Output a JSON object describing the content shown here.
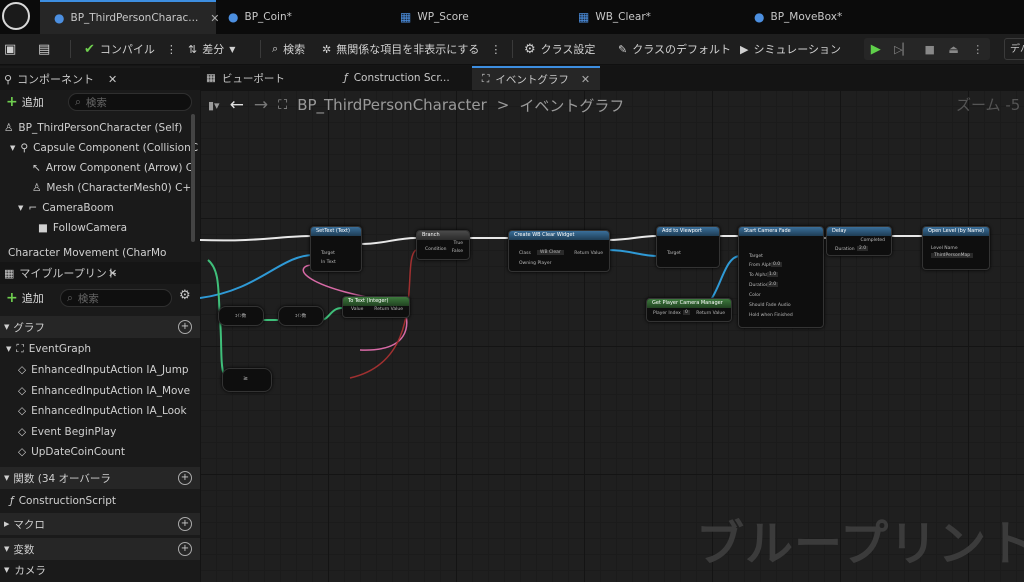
{
  "tabs": [
    {
      "label": "BP_ThirdPersonCharac...",
      "close": "✕"
    },
    {
      "label": "BP_Coin*"
    },
    {
      "label": "WP_Score"
    },
    {
      "label": "WB_Clear*"
    },
    {
      "label": "BP_MoveBox*"
    }
  ],
  "toolbar": {
    "compile": "コンパイル",
    "diff": "差分",
    "search": "検索",
    "hide_unrelated": "無関係な項目を非表示にする",
    "class_settings": "クラス設定",
    "class_defaults": "クラスのデフォルト",
    "simulation": "シミュレーション",
    "right_label": "デバ"
  },
  "components_panel": {
    "title": "コンポーネント",
    "add": "追加",
    "search_placeholder": "検索",
    "items": [
      "BP_ThirdPersonCharacter (Self)",
      "Capsule Component (CollisionC",
      "Arrow Component (Arrow)  C",
      "Mesh (CharacterMesh0)  C+",
      "CameraBoom",
      "FollowCamera",
      "Character Movement (CharMo"
    ]
  },
  "blueprint_panel": {
    "title": "マイブループリント",
    "add": "追加",
    "search_placeholder": "検索",
    "graph_header": "グラフ",
    "graph_items": [
      "EventGraph",
      "EnhancedInputAction IA_Jump",
      "EnhancedInputAction IA_Move",
      "EnhancedInputAction IA_Look",
      "Event BeginPlay",
      "UpDateCoinCount"
    ],
    "functions_header": "関数 (34 オーバーラ",
    "function_items": [
      "ConstructionScript"
    ],
    "macro_header": "マクロ",
    "variables_header": "変数",
    "variable_category": "カメラ"
  },
  "graph_tabs": {
    "viewport": "ビューポート",
    "construction": "Construction Scr...",
    "event_graph": "イベントグラフ"
  },
  "breadcrumb": {
    "blueprint": "BP_ThirdPersonCharacter",
    "separator": ">",
    "graph": "イベントグラフ",
    "zoom": "ズーム -5"
  },
  "watermark": "ブループリント",
  "nodes": {
    "set_text": {
      "title": "SetText (Text)",
      "sub": "Target is Text",
      "pins": [
        "Target",
        "In Text"
      ]
    },
    "branch": {
      "title": "Branch",
      "pins": [
        "Condition",
        "True",
        "False"
      ]
    },
    "create_widget": {
      "title": "Create WB Clear Widget",
      "pins": [
        "Class",
        "Owning Player",
        "Return Value"
      ],
      "class_value": "WB Clear"
    },
    "add_to_viewport": {
      "title": "Add to Viewport",
      "sub": "Target is User Widget",
      "pins": [
        "Target"
      ]
    },
    "start_camera_fade": {
      "title": "Start Camera Fade",
      "sub": "Target is Player Camera Manager",
      "pins": [
        "Target",
        "From Alpha",
        "To Alpha",
        "Duration",
        "Color",
        "Should Fade Audio",
        "Hold when Finished"
      ],
      "values": [
        "0.0",
        "1.0",
        "2.0"
      ]
    },
    "delay": {
      "title": "Delay",
      "pins": [
        "Duration",
        "Completed"
      ],
      "value": "2.0"
    },
    "open_level": {
      "title": "Open Level (by Name)",
      "pins": [
        "Level Name"
      ],
      "value": "ThirdPersonMap"
    },
    "to_text": {
      "title": "To Text (Integer)",
      "pins": [
        "Value",
        "Return Value"
      ]
    },
    "get_camera_manager": {
      "title": "Get Player Camera Manager",
      "pins": [
        "Player Index",
        "Return Value"
      ],
      "value": "0"
    },
    "coin_a": {
      "label": "ｺｲﾝ数"
    },
    "coin_b": {
      "label": "ｺｲﾝ数"
    },
    "compare": {
      "label": "≥"
    }
  }
}
